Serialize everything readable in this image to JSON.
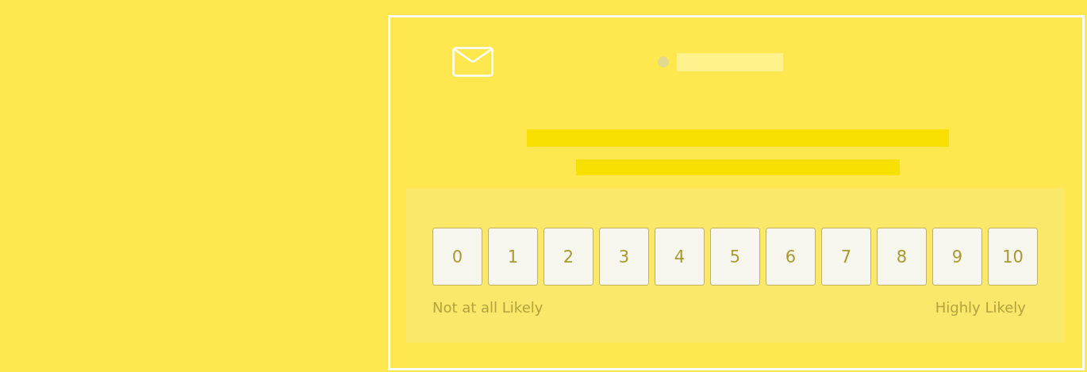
{
  "rating_scale": {
    "options": [
      "0",
      "1",
      "2",
      "3",
      "4",
      "5",
      "6",
      "7",
      "8",
      "9",
      "10"
    ],
    "low_label": "Not at all Likely",
    "high_label": "Highly Likely"
  }
}
